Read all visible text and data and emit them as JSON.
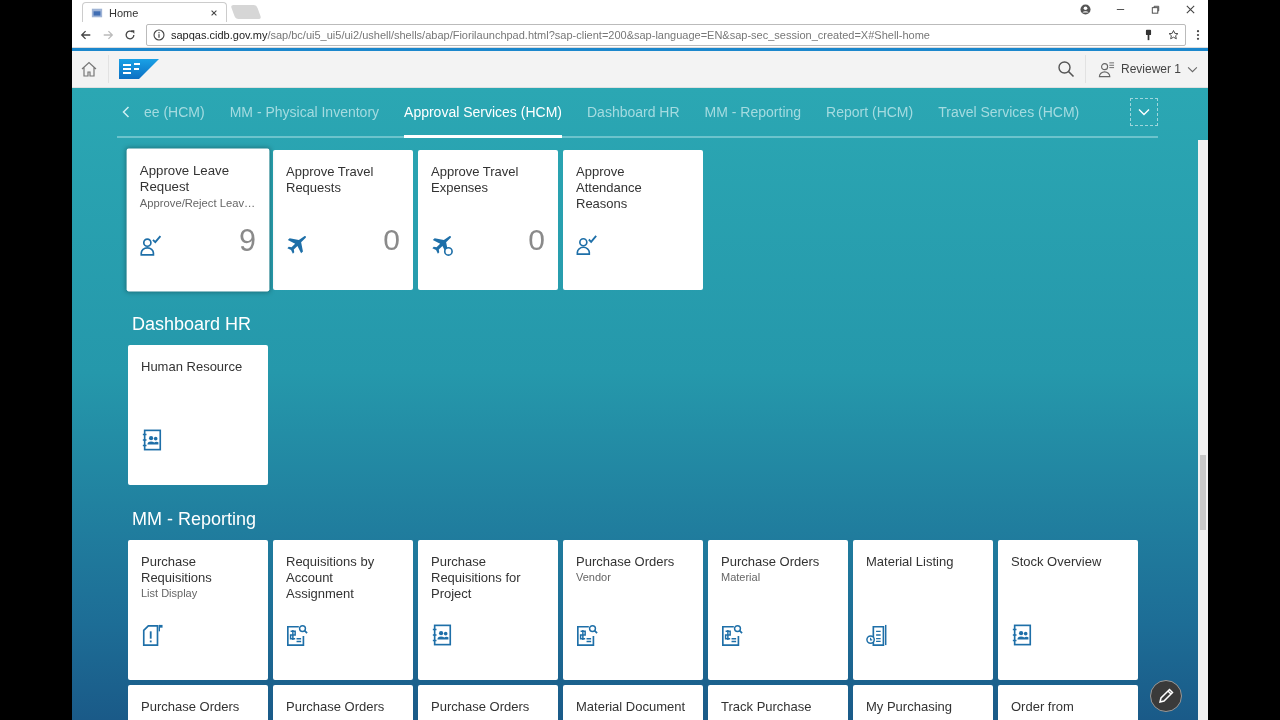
{
  "browser": {
    "tab_title": "Home",
    "url_host": "sapqas.cidb.gov.my",
    "url_path": "/sap/bc/ui5_ui5/ui2/ushell/shells/abap/Fiorilaunchpad.html?sap-client=200&sap-language=EN&sap-sec_session_created=X#Shell-home"
  },
  "shell": {
    "user": "Reviewer 1"
  },
  "anchor_tabs": [
    {
      "label": "ee (HCM)",
      "selected": false
    },
    {
      "label": "MM - Physical Inventory",
      "selected": false
    },
    {
      "label": "Approval Services (HCM)",
      "selected": true
    },
    {
      "label": "Dashboard HR",
      "selected": false
    },
    {
      "label": "MM - Reporting",
      "selected": false
    },
    {
      "label": "Report (HCM)",
      "selected": false
    },
    {
      "label": "Travel Services (HCM)",
      "selected": false
    }
  ],
  "groups": [
    {
      "tiles": [
        {
          "title": "Approve Leave Request",
          "subtitle": "Approve/Reject Leav…",
          "count": "9"
        },
        {
          "title": "Approve Travel Requests",
          "count": "0"
        },
        {
          "title": "Approve Travel Expenses",
          "count": "0"
        },
        {
          "title": "Approve Attendance Reasons"
        }
      ]
    },
    {
      "title": "Dashboard HR",
      "tiles": [
        {
          "title": "Human Resource"
        }
      ]
    },
    {
      "title": "MM - Reporting",
      "tiles": [
        {
          "title": "Purchase Requisitions",
          "subtitle": "List Display"
        },
        {
          "title": "Requisitions by Account Assignment"
        },
        {
          "title": "Purchase Requisitions for Project"
        },
        {
          "title": "Purchase Orders",
          "subtitle": "Vendor"
        },
        {
          "title": "Purchase Orders",
          "subtitle": "Material"
        },
        {
          "title": "Material Listing"
        },
        {
          "title": "Stock Overview"
        },
        {
          "title": "Purchase Orders"
        },
        {
          "title": "Purchase Orders"
        },
        {
          "title": "Purchase Orders"
        },
        {
          "title": "Material Document"
        },
        {
          "title": "Track Purchase"
        },
        {
          "title": "My Purchasing"
        },
        {
          "title": "Order from"
        }
      ]
    }
  ]
}
